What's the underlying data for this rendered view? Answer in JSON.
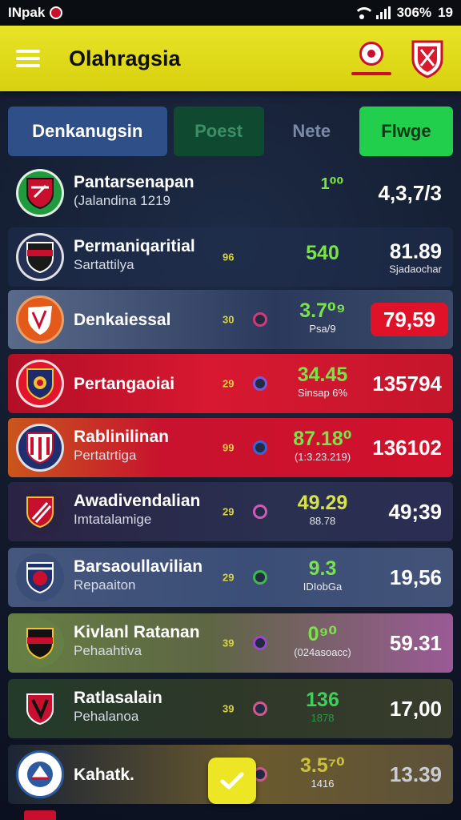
{
  "status_bar": {
    "carrier": "INpak",
    "battery": "306%",
    "time": "19"
  },
  "app_bar": {
    "title": "Olahragsia"
  },
  "tabs": [
    {
      "label": "Denkanugsin"
    },
    {
      "label": "Poest"
    },
    {
      "label": "Nete"
    },
    {
      "label": "Flwge"
    }
  ],
  "rows": [
    {
      "name": "Pantarsenapan",
      "sub": "(Jalandina 1219",
      "mini": "",
      "score": "1⁰⁰",
      "score_sub": "",
      "odds": "4,3,7/3",
      "odds_sub": ""
    },
    {
      "name": "Permaniqaritial",
      "sub": "Sartattilya",
      "mini": "96",
      "score": "540",
      "score_sub": "",
      "odds": "81.89",
      "odds_sub": "Sjadaochar"
    },
    {
      "name": "Denkaiessal",
      "sub": "",
      "mini": "30",
      "score": "3.7⁰⁹",
      "score_sub": "Psa/9",
      "odds": "79,59",
      "odds_sub": ""
    },
    {
      "name": "Pertangaoiai",
      "sub": "",
      "mini": "29",
      "score": "34.45",
      "score_sub": "Sinsap 6%",
      "odds": "135794",
      "odds_sub": ""
    },
    {
      "name": "Rablinilinan",
      "sub": "Pertatrtiga",
      "mini": "99",
      "score": "87.18⁰",
      "score_sub": "(1:3.23.219)",
      "odds": "136102",
      "odds_sub": ""
    },
    {
      "name": "Awadivendalian",
      "sub": "Imtatalamige",
      "mini": "29",
      "score": "49.29",
      "score_sub": "88.78",
      "odds": "49;39",
      "odds_sub": ""
    },
    {
      "name": "Barsaoullavilian",
      "sub": "Repaaiton",
      "mini": "29",
      "score": "9.3",
      "score_sub": "IDIobGa",
      "odds": "19,56",
      "odds_sub": ""
    },
    {
      "name": "Kivlanl Ratanan",
      "sub": "Pehaahtiva",
      "mini": "39",
      "score": "0⁹⁰",
      "score_sub": "(024asoacc)",
      "odds": "59.31",
      "odds_sub": ""
    },
    {
      "name": "Ratlasalain",
      "sub": "Pehalanoa",
      "mini": "39",
      "score": "136",
      "score_sub": "1878",
      "odds": "17,00",
      "odds_sub": ""
    },
    {
      "name": "Kahatk.",
      "sub": "",
      "mini": "",
      "score": "3.5⁷⁰",
      "score_sub": "1416",
      "odds": "13.39",
      "odds_sub": ""
    }
  ],
  "colors": {
    "accent_yellow": "#e8e327",
    "accent_green": "#22cf4d",
    "accent_red": "#e0122a"
  },
  "icons": [
    "hamburger-icon",
    "notification-badge-icon",
    "club-shield-icon",
    "check-icon"
  ]
}
